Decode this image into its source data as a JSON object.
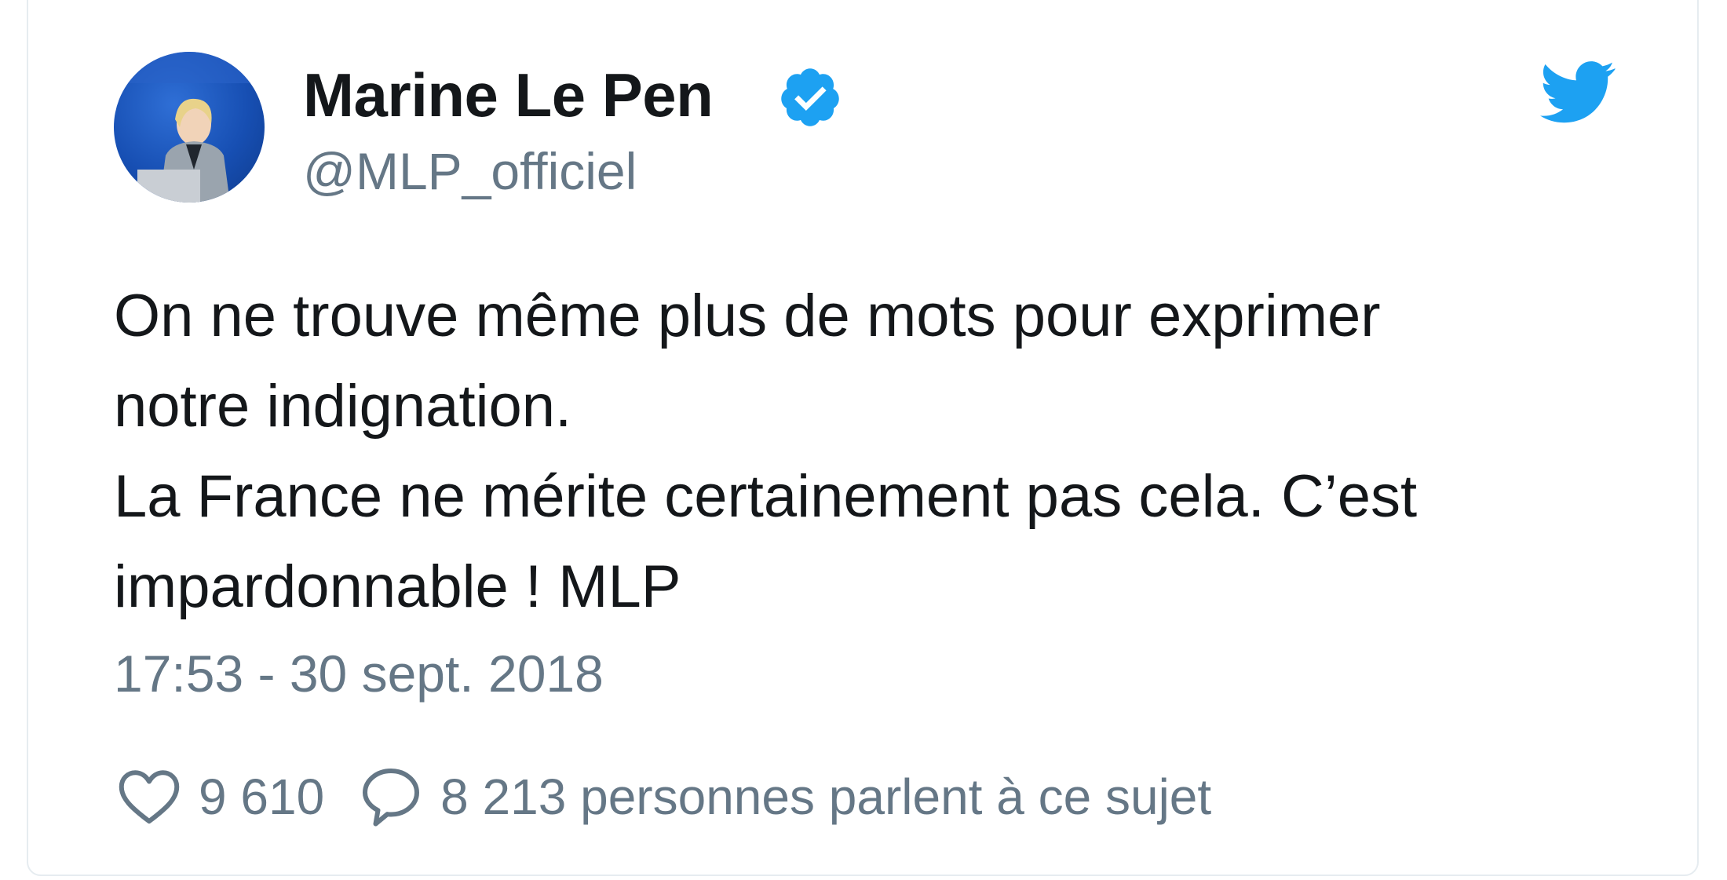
{
  "tweet": {
    "author_name": "Marine Le Pen",
    "author_handle": "@MLP_officiel",
    "verified": true,
    "text_lines": [
      "On ne trouve même plus de mots pour exprimer",
      "notre indignation.",
      "La France ne mérite certainement pas cela. C’est",
      "impardonnable ! MLP"
    ],
    "timestamp": "17:53 - 30 sept. 2018",
    "likes": "9 610",
    "conversation": "8 213 personnes parlent à ce sujet"
  },
  "icons": {
    "brand": "twitter-bird-icon",
    "verified": "verified-badge-icon",
    "like": "heart-icon",
    "reply": "speech-bubble-icon"
  },
  "colors": {
    "brand_blue": "#1da1f2",
    "text": "#14171a",
    "secondary_text": "#657786",
    "border": "#e6ecf0"
  }
}
